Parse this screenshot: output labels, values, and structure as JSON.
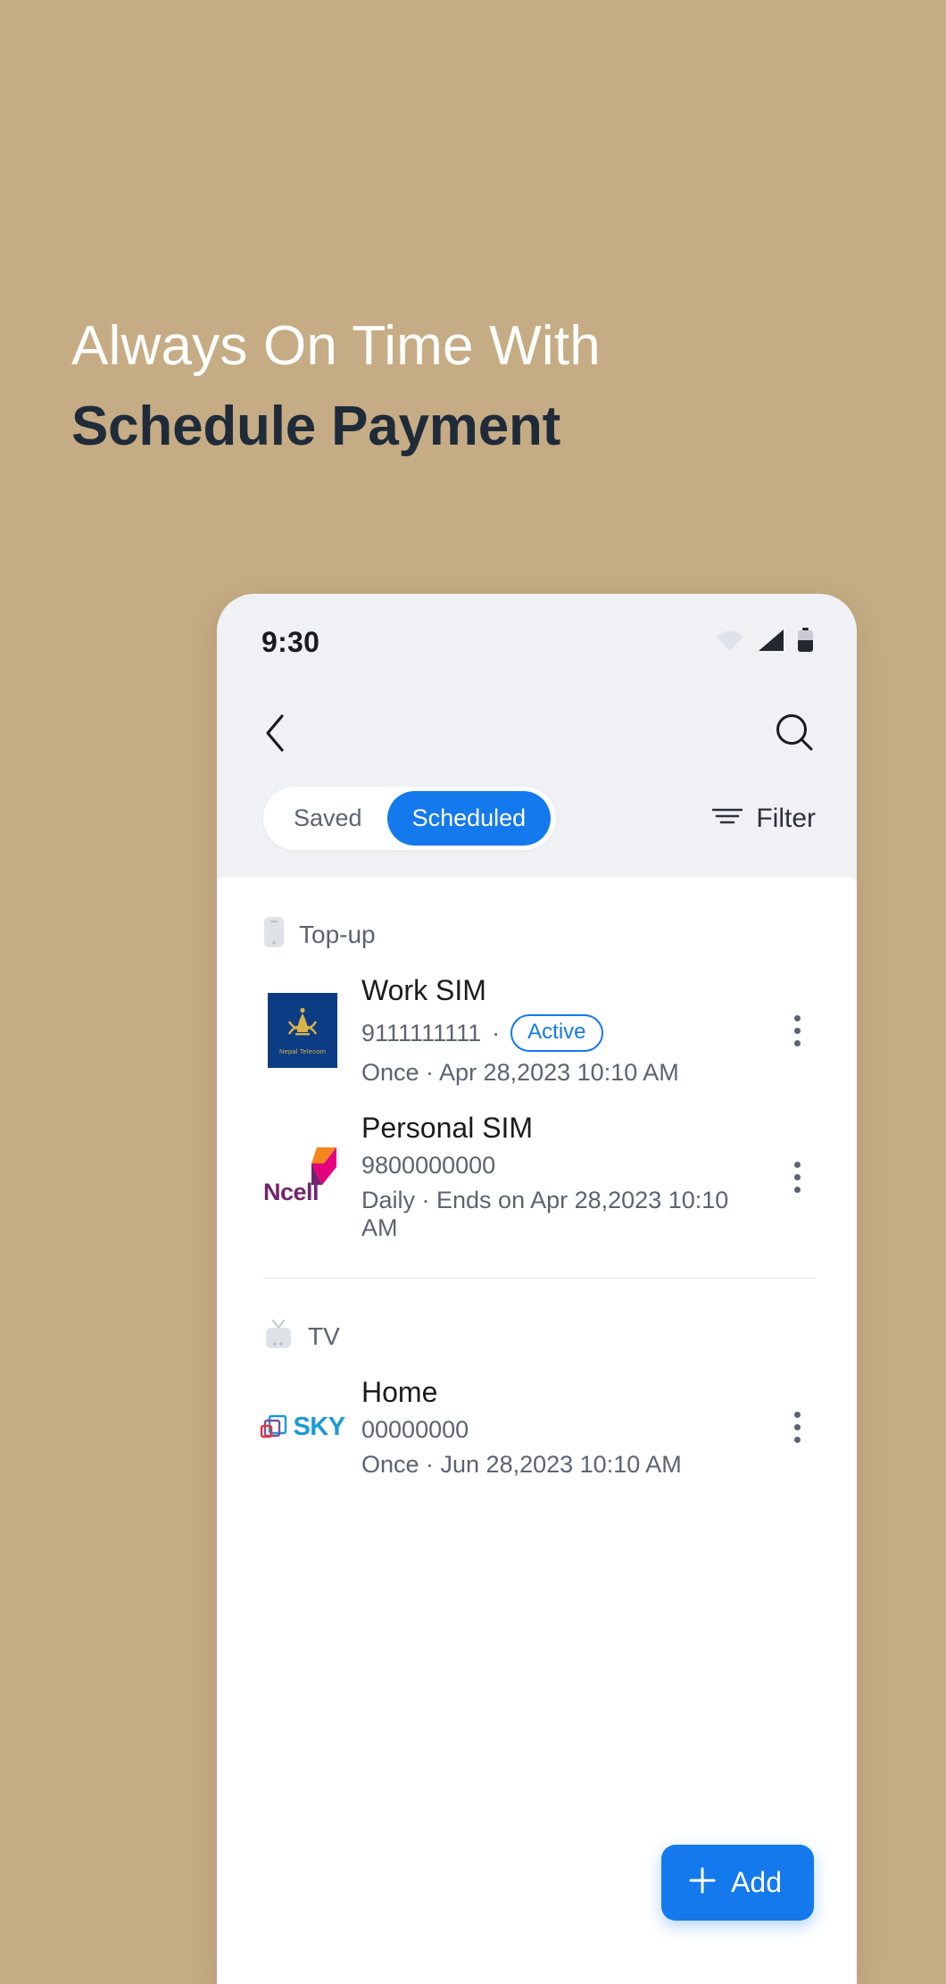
{
  "promo": {
    "line1": "Always On Time With",
    "line2": "Schedule Payment",
    "bg_color": "#c6ac84",
    "line1_color": "#ffffff",
    "line2_color": "#1f2b39"
  },
  "status_bar": {
    "time": "9:30",
    "icons": [
      "wifi-icon",
      "cellular-signal-icon",
      "battery-icon"
    ]
  },
  "nav": {
    "back_icon": "chevron-left-icon",
    "search_icon": "search-icon"
  },
  "tabs": {
    "items": [
      {
        "label": "Saved",
        "active": false
      },
      {
        "label": "Scheduled",
        "active": true
      }
    ],
    "active_color": "#1479ec",
    "filter": {
      "label": "Filter",
      "icon": "filter-lines-icon"
    }
  },
  "sections": [
    {
      "title": "Top-up",
      "icon": "mobile-phone-icon",
      "rows": [
        {
          "logo": "nepal-telecom-logo",
          "logo_word": "Nepal Telecom",
          "title": "Work SIM",
          "number": "9111111111",
          "separator": "·",
          "badge": "Active",
          "meta": "Once · Apr 28,2023 10:10 AM",
          "menu_icon": "more-vertical-icon"
        },
        {
          "logo": "ncell-logo",
          "logo_word": "Ncell",
          "title": "Personal SIM",
          "number": "9800000000",
          "separator": "",
          "badge": "",
          "meta": "Daily · Ends on Apr 28,2023 10:10 AM",
          "menu_icon": "more-vertical-icon"
        }
      ]
    },
    {
      "title": "TV",
      "icon": "television-icon",
      "rows": [
        {
          "logo": "sky-logo",
          "logo_word": "SKY",
          "title": "Home",
          "number": "00000000",
          "separator": "",
          "badge": "",
          "meta": "Once · Jun 28,2023 10:10 AM",
          "menu_icon": "more-vertical-icon"
        }
      ]
    }
  ],
  "fab": {
    "label": "Add",
    "icon": "plus-icon",
    "color": "#1479ec"
  }
}
